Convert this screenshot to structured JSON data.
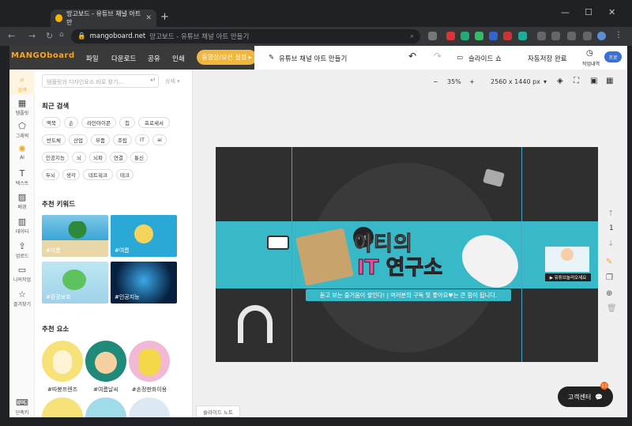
{
  "browser": {
    "tab_title": "망고보드 - 유튜브 채널 아트 만",
    "url_host": "mangoboard.net",
    "url_rest": "망고보드 - 유튜브 채널 아트 만들기"
  },
  "app": {
    "logo": "MANGOboard",
    "menu": [
      "파일",
      "다운로드",
      "공유",
      "인쇄"
    ],
    "video_button": "동영상/모션 설정 ▸",
    "doc_title": "유튜브 채널 아트 만들기",
    "slideshow": "슬라이드 쇼",
    "autosave": "자동저장 완료",
    "history": "작업내역",
    "zoom": "35%",
    "canvas_size": "2560 x 1440 px"
  },
  "sidebar": [
    {
      "label": "검색",
      "icon": "search-icon"
    },
    {
      "label": "템플릿",
      "icon": "template-icon"
    },
    {
      "label": "그래픽",
      "icon": "graphic-icon"
    },
    {
      "label": "AI",
      "icon": "ai-icon"
    },
    {
      "label": "텍스트",
      "icon": "text-icon"
    },
    {
      "label": "배경",
      "icon": "background-icon"
    },
    {
      "label": "데이터",
      "icon": "chart-icon"
    },
    {
      "label": "업로드",
      "icon": "upload-icon"
    },
    {
      "label": "나의작업",
      "icon": "folder-icon"
    },
    {
      "label": "즐겨찾기",
      "icon": "star-icon"
    },
    {
      "label": "단축키",
      "icon": "keyboard-icon"
    }
  ],
  "panel": {
    "search_placeholder": "템플릿과 디자인요소 바로 찾기...",
    "detail": "상세 ▾",
    "recent_title": "최근 검색",
    "recent": [
      "액북",
      "손",
      "라인아이콘",
      "칩",
      "프로세서",
      "반도체",
      "산업",
      "부품",
      "조립",
      "IT",
      "ai",
      "인공지능",
      "뇌",
      "뇌파",
      "연결",
      "통신",
      "두뇌",
      "생각",
      "네트워크",
      "테크"
    ],
    "keyword_title": "추천 키워드",
    "keywords": [
      "#여름",
      "#여름",
      "#환경보호",
      "#인공지능"
    ],
    "elements_title": "추천 요소",
    "elements": [
      "#따봉프렌즈",
      "#여름날씨",
      "#손정판화이용"
    ]
  },
  "canvas": {
    "title_line1": "아티의",
    "title_line2": "IT 연구소",
    "badge": "IT 테크",
    "subtitle": "듣고 보는 즐거움이 쌓인다! | 여러분의 구독 및 좋아요♥는 큰 힘이 됩니다.",
    "youtube_badge": "▶ 유튜브놀러오세요",
    "page_number": "1"
  },
  "help": {
    "label": "고객센터",
    "badge": "11"
  },
  "slide_note": "슬라이드 노트"
}
